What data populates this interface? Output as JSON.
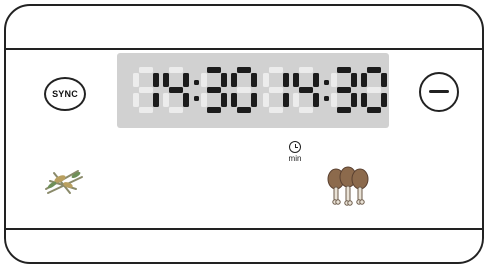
{
  "display": {
    "time_left": "14:30",
    "time_right": "14:30",
    "segment_color_on": "#1c1c1c",
    "segment_color_off": "#ececec",
    "background": "#d1d1d1"
  },
  "buttons": {
    "sync_label": "SYNC",
    "minus_icon": "minus-icon"
  },
  "timer": {
    "icon": "clock-icon",
    "unit_label": "min"
  },
  "icons": {
    "left": "vegetables-icon",
    "right": "drumsticks-icon"
  }
}
